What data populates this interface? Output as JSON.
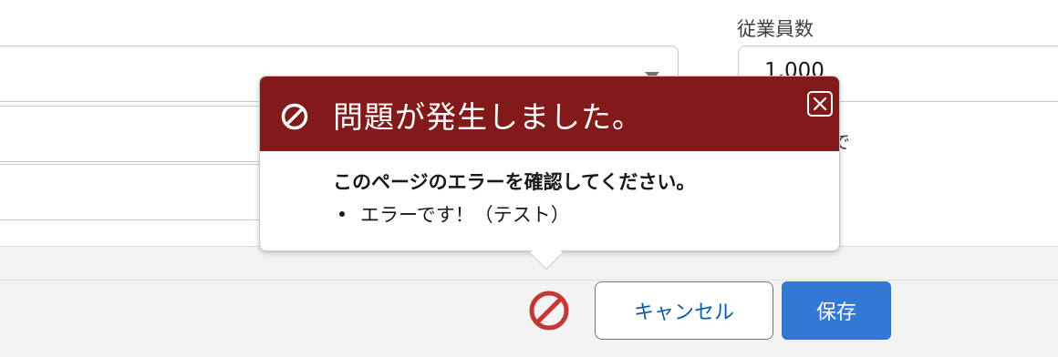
{
  "form": {
    "employees_label": "従業員数",
    "employees_value": "1,000",
    "employees_help_fragment": "で"
  },
  "footer": {
    "cancel_label": "キャンセル",
    "save_label": "保存"
  },
  "error_popover": {
    "title": "問題が発生しました。",
    "message": "このページのエラーを確認してください。",
    "errors": [
      "エラーです！（テスト）"
    ]
  },
  "colors": {
    "error_header": "#831a1a",
    "error_icon": "#c23934",
    "brand_button": "#3279d5",
    "cancel_text": "#0b5cab"
  },
  "icons": {
    "header": "ban-icon",
    "close": "close-icon",
    "footer_error": "error-ban-icon",
    "select_arrow": "chevron-down-icon"
  }
}
